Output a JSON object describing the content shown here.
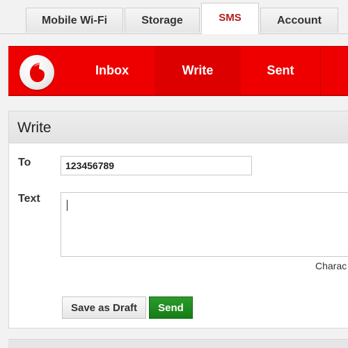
{
  "top_tabs": {
    "mobile_wifi": "Mobile Wi-Fi",
    "storage": "Storage",
    "sms": "SMS",
    "account": "Account"
  },
  "nav": {
    "inbox": "Inbox",
    "write": "Write",
    "sent": "Sent"
  },
  "write": {
    "title": "Write",
    "to_label": "To",
    "to_value": "123456789",
    "text_label": "Text",
    "char_count_label": "Charac",
    "save_draft_label": "Save as Draft",
    "send_label": "Send"
  },
  "icons": {
    "logo": "vodafone-logo-icon"
  },
  "colors": {
    "brand_red": "#ee0000",
    "active_nav": "#dd0000",
    "active_tab_text": "#b31b1b",
    "send_green": "#1f8c1f"
  }
}
